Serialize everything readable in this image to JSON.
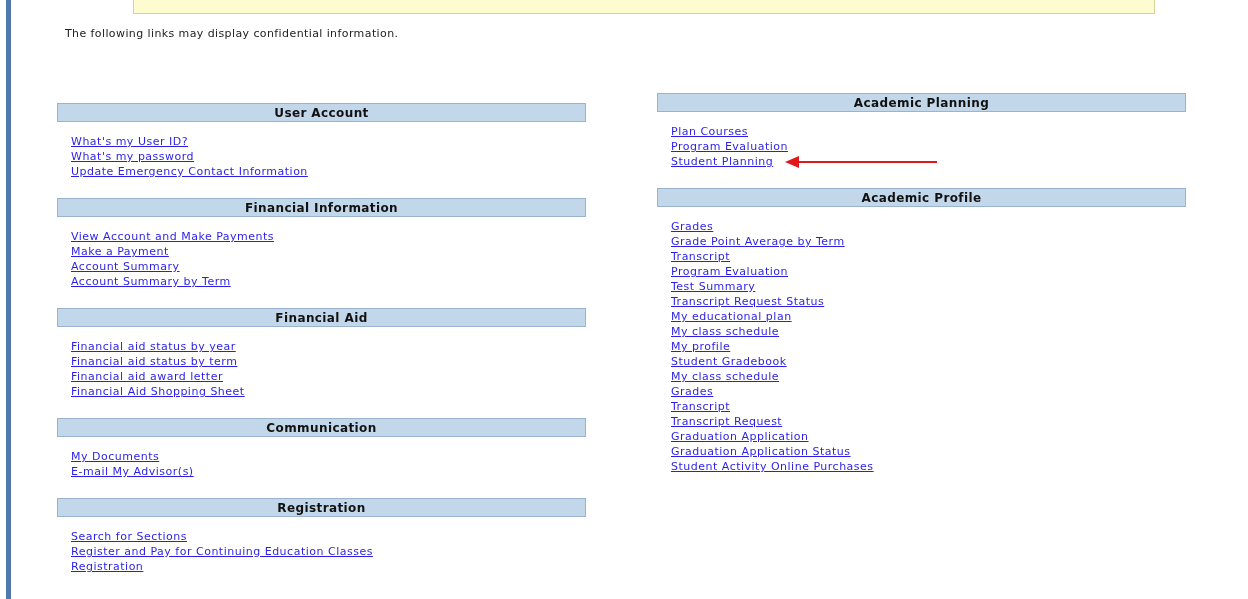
{
  "notice": "The following links may display confidential information.",
  "left_column": [
    {
      "title": "User Account",
      "links": [
        {
          "label": "What's my User ID?",
          "arrow": false
        },
        {
          "label": "What's my password",
          "arrow": false
        },
        {
          "label": "Update Emergency Contact Information",
          "arrow": false
        }
      ]
    },
    {
      "title": "Financial Information",
      "links": [
        {
          "label": "View Account and Make Payments",
          "arrow": false
        },
        {
          "label": "Make a Payment",
          "arrow": false
        },
        {
          "label": "Account Summary",
          "arrow": false
        },
        {
          "label": "Account Summary by Term",
          "arrow": false
        }
      ]
    },
    {
      "title": "Financial Aid",
      "links": [
        {
          "label": "Financial aid status by year",
          "arrow": false
        },
        {
          "label": "Financial aid status by term",
          "arrow": false
        },
        {
          "label": "Financial aid award letter",
          "arrow": false
        },
        {
          "label": "Financial Aid Shopping Sheet",
          "arrow": false
        }
      ]
    },
    {
      "title": "Communication",
      "links": [
        {
          "label": "My Documents",
          "arrow": false
        },
        {
          "label": "E-mail My Advisor(s)",
          "arrow": false
        }
      ]
    },
    {
      "title": "Registration",
      "links": [
        {
          "label": "Search for Sections",
          "arrow": false
        },
        {
          "label": "Register and Pay for Continuing Education Classes",
          "arrow": false
        },
        {
          "label": "Registration",
          "arrow": false
        }
      ]
    }
  ],
  "right_column": [
    {
      "title": "Academic Planning",
      "links": [
        {
          "label": "Plan Courses",
          "arrow": false
        },
        {
          "label": "Program Evaluation",
          "arrow": false
        },
        {
          "label": "Student Planning",
          "arrow": true
        }
      ]
    },
    {
      "title": "Academic Profile",
      "links": [
        {
          "label": "Grades",
          "arrow": false
        },
        {
          "label": "Grade Point Average by Term",
          "arrow": false
        },
        {
          "label": "Transcript",
          "arrow": false
        },
        {
          "label": "Program Evaluation",
          "arrow": false
        },
        {
          "label": "Test Summary",
          "arrow": false
        },
        {
          "label": "Transcript Request Status",
          "arrow": false
        },
        {
          "label": "My educational plan",
          "arrow": false
        },
        {
          "label": "My class schedule",
          "arrow": false
        },
        {
          "label": "My profile",
          "arrow": false
        },
        {
          "label": "Student Gradebook",
          "arrow": false
        },
        {
          "label": "My class schedule",
          "arrow": false
        },
        {
          "label": "Grades",
          "arrow": false
        },
        {
          "label": "Transcript",
          "arrow": false
        },
        {
          "label": "Transcript Request",
          "arrow": false
        },
        {
          "label": "Graduation Application",
          "arrow": false
        },
        {
          "label": "Graduation Application Status",
          "arrow": false
        },
        {
          "label": "Student Activity Online Purchases",
          "arrow": false
        }
      ]
    }
  ]
}
